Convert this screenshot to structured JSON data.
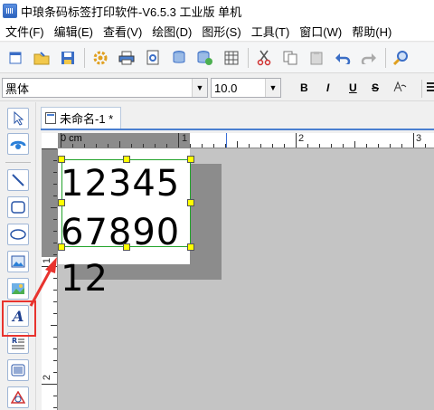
{
  "window": {
    "title": "中琅条码标签打印软件-V6.5.3 工业版 单机"
  },
  "menu": {
    "items": [
      "文件(F)",
      "编辑(E)",
      "查看(V)",
      "绘图(D)",
      "图形(S)",
      "工具(T)",
      "窗口(W)",
      "帮助(H)"
    ]
  },
  "toolbar": {
    "icons": [
      "new-file-icon",
      "open-folder-icon",
      "save-icon",
      "settings-gear-icon",
      "print-icon",
      "print-preview-icon",
      "database-icon",
      "database-settings-icon",
      "grid-icon",
      "cut-icon",
      "copy-icon",
      "paste-icon",
      "undo-icon",
      "redo-icon",
      "zoom-icon"
    ]
  },
  "format": {
    "font_name": "黑体",
    "font_size": "10.0",
    "bold_label": "B",
    "italic_label": "I",
    "underline_label": "U",
    "strike_label": "S"
  },
  "tools": {
    "icons": [
      "select-arrow-icon",
      "pan-icon",
      "line-icon",
      "rounded-rect-icon",
      "ellipse-icon",
      "image-icon",
      "picture-icon",
      "text-icon",
      "rich-text-icon",
      "barcode-icon",
      "shape-icon"
    ]
  },
  "document": {
    "tab_label": "未命名-1 *"
  },
  "ruler": {
    "h_labels": [
      "0 cm",
      "1",
      "2",
      "3"
    ],
    "v_labels": [
      "1",
      "2"
    ]
  },
  "canvas": {
    "text_line1": "12345",
    "text_line2": "67890",
    "text_overflow": "12"
  },
  "colors": {
    "highlight": "#e8332e",
    "selection": "#22a32a",
    "handle": "#ffff00",
    "canvas_bg": "#c4c4c4"
  }
}
